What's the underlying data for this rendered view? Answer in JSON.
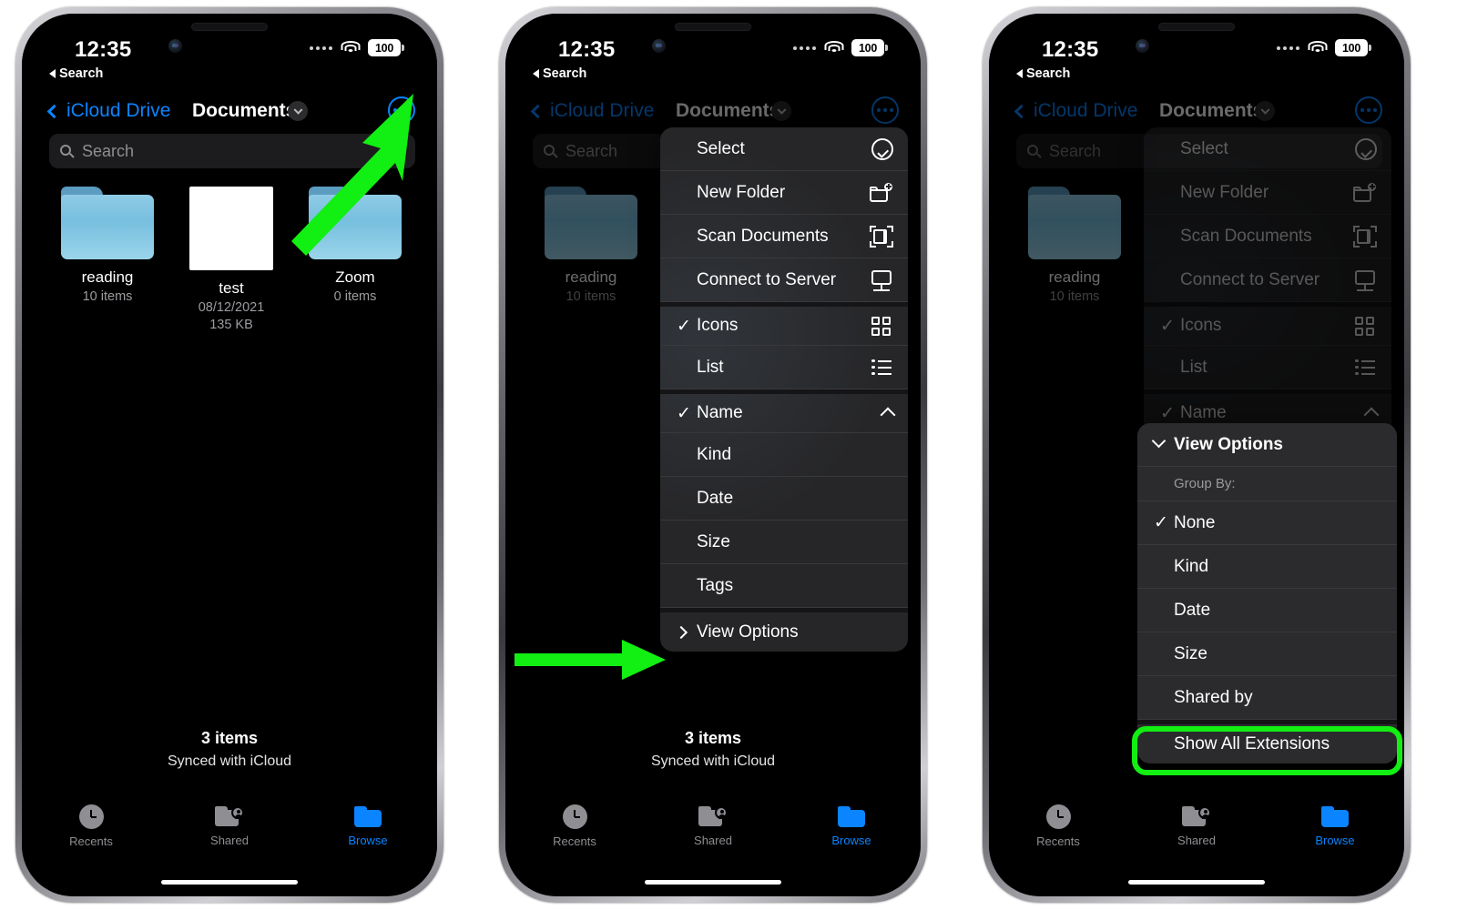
{
  "status": {
    "time": "12:35",
    "back_app": "Search",
    "battery": "100",
    "wifi_icon": "wifi-icon",
    "cell_icon": "cellular-dots-icon"
  },
  "nav": {
    "back_label": "iCloud Drive",
    "title": "Documents",
    "chevron_icon": "chevron-down-icon",
    "more_icon": "ellipsis-circle-icon"
  },
  "search": {
    "placeholder": "Search",
    "icon": "search-icon"
  },
  "files": [
    {
      "name": "reading",
      "meta1": "10 items",
      "meta2": "",
      "type": "folder"
    },
    {
      "name": "test",
      "meta1": "08/12/2021",
      "meta2": "135 KB",
      "type": "document"
    },
    {
      "name": "Zoom",
      "meta1": "0 items",
      "meta2": "",
      "type": "folder"
    }
  ],
  "footer": {
    "count": "3 items",
    "sync": "Synced with iCloud"
  },
  "tabs": [
    {
      "label": "Recents",
      "icon": "clock-icon",
      "active": false
    },
    {
      "label": "Shared",
      "icon": "shared-folder-icon",
      "active": false
    },
    {
      "label": "Browse",
      "icon": "folder-icon",
      "active": true
    }
  ],
  "context_menu": [
    {
      "label": "Select",
      "icon": "checkmark-circle-icon",
      "checked": false
    },
    {
      "label": "New Folder",
      "icon": "folder-plus-icon",
      "checked": false
    },
    {
      "label": "Scan Documents",
      "icon": "scan-document-icon",
      "checked": false
    },
    {
      "label": "Connect to Server",
      "icon": "monitor-icon",
      "checked": false
    },
    {
      "label": "Icons",
      "icon": "grid-icon",
      "checked": true
    },
    {
      "label": "List",
      "icon": "list-icon",
      "checked": false
    },
    {
      "label": "Name",
      "icon": "chevron-up-icon",
      "checked": true
    },
    {
      "label": "Kind",
      "icon": "",
      "checked": false
    },
    {
      "label": "Date",
      "icon": "",
      "checked": false
    },
    {
      "label": "Size",
      "icon": "",
      "checked": false
    },
    {
      "label": "Tags",
      "icon": "",
      "checked": false
    },
    {
      "label": "View Options",
      "icon": "chevron-right-icon",
      "checked": false
    }
  ],
  "submenu": {
    "title": "View Options",
    "title_icon": "chevron-down-icon",
    "group_label": "Group By:",
    "items": [
      {
        "label": "None",
        "checked": true
      },
      {
        "label": "Kind",
        "checked": false
      },
      {
        "label": "Date",
        "checked": false
      },
      {
        "label": "Size",
        "checked": false
      },
      {
        "label": "Shared by",
        "checked": false
      },
      {
        "label": "Show All Extensions",
        "checked": false
      }
    ]
  },
  "annotations": {
    "accent_color": "#12ef12",
    "arrow1_target": "ellipsis-circle-icon",
    "arrow2_target": "View Options",
    "highlight_target": "Show All Extensions"
  }
}
